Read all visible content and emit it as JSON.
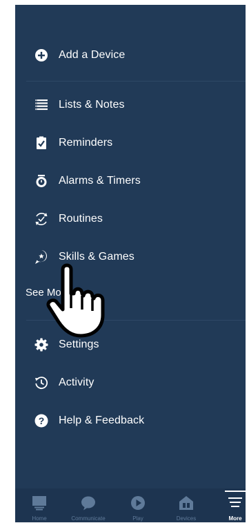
{
  "menu": {
    "add_device": "Add a Device",
    "lists_notes": "Lists & Notes",
    "reminders": "Reminders",
    "alarms_timers": "Alarms & Timers",
    "routines": "Routines",
    "skills_games": "Skills & Games",
    "see_more": "See More",
    "settings": "Settings",
    "activity": "Activity",
    "help_feedback": "Help & Feedback"
  },
  "tabs": [
    {
      "label": "Home",
      "icon": "home-icon"
    },
    {
      "label": "Communicate",
      "icon": "chat-bubble-icon"
    },
    {
      "label": "Play",
      "icon": "play-icon"
    },
    {
      "label": "Devices",
      "icon": "devices-icon"
    },
    {
      "label": "More",
      "icon": "menu-lines-icon",
      "active": true
    }
  ],
  "colors": {
    "background": "#213a57",
    "tabbar": "#1d3450",
    "text": "#ffffff",
    "tab_inactive": "#5f7a99"
  }
}
